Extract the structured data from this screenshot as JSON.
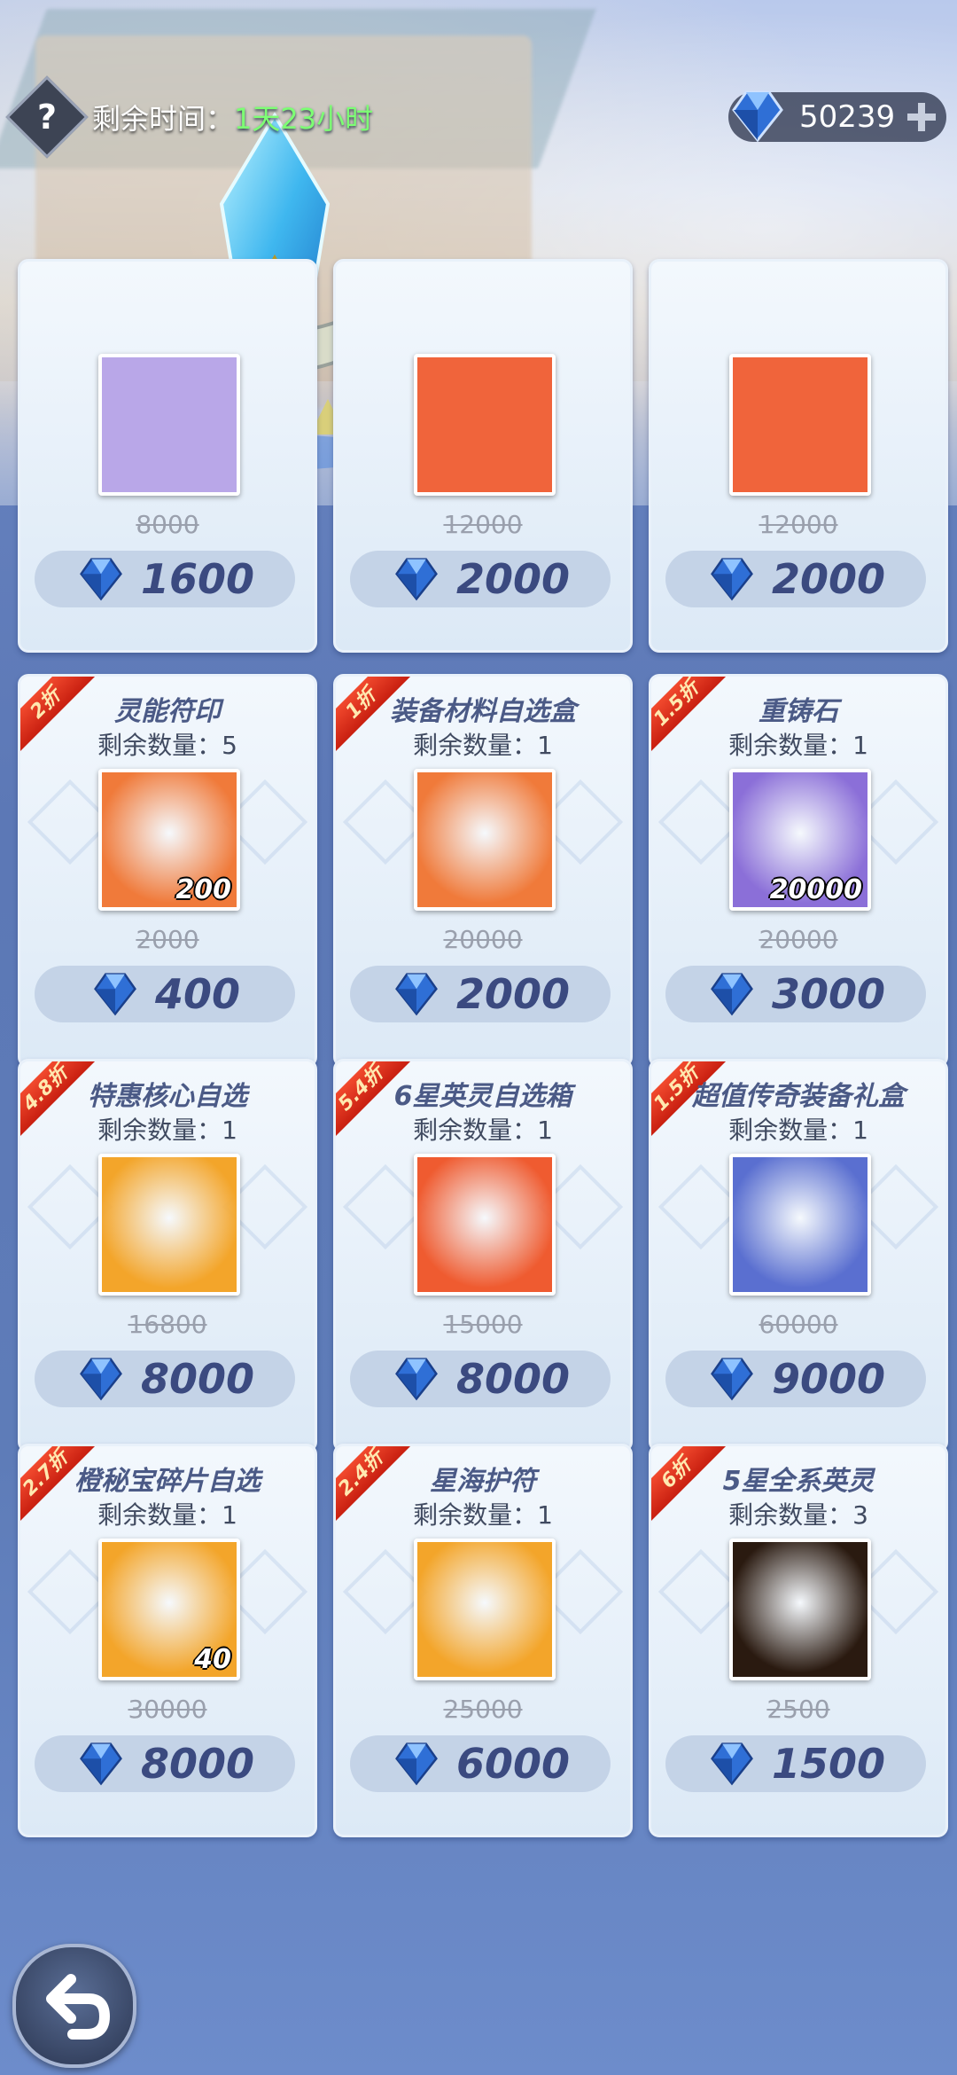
{
  "header": {
    "help_icon_label": "?",
    "timer_label": "剩余时间：",
    "timer_value": "1天23小时",
    "currency_value": "50239",
    "currency_icon": "diamond-icon",
    "add_icon": "plus-icon"
  },
  "colors": {
    "timer_value": "#7dff74",
    "price_text": "#3b4a80",
    "ribbon": "#e0321d",
    "gem": "#3d7bd8"
  },
  "top_row_partial": [
    {
      "orig_price": "8000",
      "price": "1600",
      "icon_color": "#b9a7e8"
    },
    {
      "orig_price": "12000",
      "price": "2000",
      "icon_color": "#f0643b"
    },
    {
      "orig_price": "12000",
      "price": "2000",
      "icon_color": "#f0643b"
    }
  ],
  "items": [
    {
      "discount": "2折",
      "name": "灵能符印",
      "remain_label": "剩余数量：",
      "remain": "5",
      "icon": "psychic-seal-icon",
      "qty": "200",
      "orig_price": "2000",
      "price": "400",
      "bg": "#f07a3a"
    },
    {
      "discount": "1折",
      "name": "装备材料自选盒",
      "remain_label": "剩余数量：",
      "remain": "1",
      "icon": "armor-box-icon",
      "qty": "",
      "orig_price": "20000",
      "price": "2000",
      "bg": "#f07a3a"
    },
    {
      "discount": "1.5折",
      "name": "重铸石",
      "remain_label": "剩余数量：",
      "remain": "1",
      "icon": "reforge-stone-icon",
      "qty": "20000",
      "orig_price": "20000",
      "price": "3000",
      "bg": "#8b6fd8"
    },
    {
      "discount": "4.8折",
      "name": "特惠核心自选",
      "remain_label": "剩余数量：",
      "remain": "1",
      "icon": "core-card-icon",
      "qty": "",
      "orig_price": "16800",
      "price": "8000",
      "bg": "#f3a52a"
    },
    {
      "discount": "5.4折",
      "name": "6星英灵自选箱",
      "remain_label": "剩余数量：",
      "remain": "1",
      "icon": "hero-helmet-icon",
      "qty": "",
      "orig_price": "15000",
      "price": "8000",
      "bg": "#ef5b30"
    },
    {
      "discount": "1.5折",
      "name": "超值传奇装备礼盒",
      "remain_label": "剩余数量：",
      "remain": "1",
      "icon": "legendary-armor-icon",
      "qty": "",
      "orig_price": "60000",
      "price": "9000",
      "bg": "#5a6fd0"
    },
    {
      "discount": "2.7折",
      "name": "橙秘宝碎片自选",
      "remain_label": "剩余数量：",
      "remain": "1",
      "icon": "treasure-chest-icon",
      "qty": "40",
      "orig_price": "30000",
      "price": "8000",
      "bg": "#f3a52a"
    },
    {
      "discount": "2.4折",
      "name": "星海护符",
      "remain_label": "剩余数量：",
      "remain": "1",
      "icon": "amulet-icon",
      "qty": "",
      "orig_price": "25000",
      "price": "6000",
      "bg": "#f3a52a"
    },
    {
      "discount": "6折",
      "name": "5星全系英灵",
      "remain_label": "剩余数量：",
      "remain": "3",
      "icon": "five-star-hero-icon",
      "qty": "",
      "orig_price": "2500",
      "price": "1500",
      "bg": "#2a1a10"
    }
  ],
  "back_button_icon": "back-arrow-icon"
}
